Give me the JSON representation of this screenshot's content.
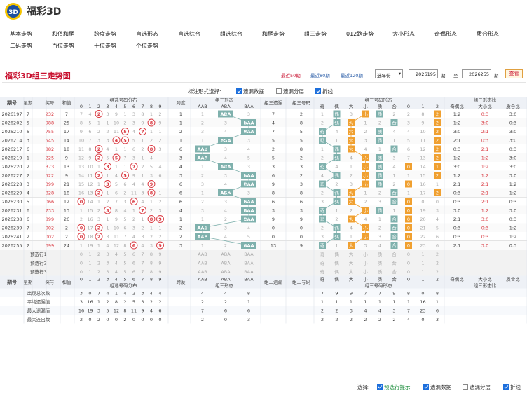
{
  "app": {
    "brand": "福彩3D"
  },
  "nav": [
    "基本走势",
    "和值和尾",
    "跨度走势",
    "直选形态",
    "直选综合",
    "组选综合",
    "和尾走势",
    "组三走势",
    "012路走势",
    "大小形态",
    "奇偶形态",
    "质合形态",
    "二码走势",
    "百位走势",
    "十位走势",
    "个位走势"
  ],
  "page": {
    "title": "福彩3D组三走势图",
    "q50": "最近50期",
    "q80": "最近80期",
    "q120": "最近120期",
    "sel": "选年份",
    "from": "2026195",
    "to": "2026255",
    "qi1": "期",
    "zhi": "至",
    "qi2": "期",
    "btn": "查看"
  },
  "opts": {
    "label": "标注形式选择:",
    "o1": "遗漏数据",
    "o2": "遗漏分层",
    "o3": "折线"
  },
  "bottom": {
    "label": "选择:",
    "o1": "预选行提示",
    "o2": "遗漏数据",
    "o3": "遗漏分层",
    "o4": "折线"
  },
  "headers": {
    "qh": "期号",
    "xq": "星期",
    "kj": "奖号",
    "hz": "和值",
    "fb": "组选号码分布",
    "kd": "跨度",
    "xt": "组三形态",
    "yl": "组三遗漏",
    "hm": "组三号码",
    "zx": "组三号码形态",
    "bz": "组三形态比",
    "jo": "奇偶比",
    "dx": "大小比",
    "zh": "质合比",
    "xt3": [
      "AAB",
      "ABA",
      "BAA"
    ],
    "zx10": [
      "奇",
      "偶",
      "大",
      "小",
      "质",
      "合",
      "0",
      "1",
      "2"
    ],
    "digits": [
      "0",
      "1",
      "2",
      "3",
      "4",
      "5",
      "6",
      "7",
      "8",
      "9"
    ]
  },
  "colors": {
    "red": "#d9363e",
    "teal": "#7fb1ad",
    "orange": "#f0a030",
    "gray": "#aaaaaa"
  },
  "rows": [
    [
      "2026197",
      "7",
      "232",
      "7",
      [
        7,
        4,
        "2",
        3,
        9,
        1,
        3,
        8,
        1,
        2
      ],
      "1",
      "ABA",
      7,
      "2",
      [
        0,
        0,
        0,
        0,
        0,
        0,
        2,
        8,
        "2"
      ],
      "1:2",
      "0:3",
      "3:0"
    ],
    [
      "2026202",
      "5",
      "988",
      "25",
      [
        8,
        5,
        1,
        1,
        10,
        2,
        3,
        9,
        "8",
        9
      ],
      "1",
      "BAA",
      4,
      "8",
      [
        0,
        0,
        0,
        0,
        0,
        0,
        3,
        9,
        "2"
      ],
      "1:2",
      "3:0",
      "0:3"
    ],
    [
      "2026210",
      "6",
      "755",
      "17",
      [
        9,
        6,
        2,
        2,
        11,
        "5",
        4,
        "7",
        1,
        1
      ],
      "2",
      "BAA",
      7,
      "5",
      [
        0,
        0,
        0,
        0,
        0,
        0,
        4,
        10,
        "2"
      ],
      "3:0",
      "2:1",
      "3:0"
    ],
    [
      "2026214",
      "3",
      "545",
      "14",
      [
        10,
        7,
        3,
        3,
        "4",
        "5",
        5,
        1,
        2,
        2
      ],
      "1",
      "ABA",
      5,
      "5",
      [
        0,
        0,
        0,
        0,
        0,
        0,
        5,
        11,
        "2"
      ],
      "2:1",
      "0:3",
      "3:0"
    ],
    [
      "2026217",
      "6",
      "882",
      "18",
      [
        11,
        8,
        "2",
        4,
        1,
        1,
        6,
        2,
        "8",
        3
      ],
      "6",
      "AAB",
      2,
      "8",
      [
        0,
        0,
        0,
        0,
        0,
        0,
        6,
        12,
        "2"
      ],
      "0:3",
      "2:1",
      "0:3"
    ],
    [
      "2026219",
      "1",
      "225",
      "9",
      [
        12,
        9,
        "2",
        5,
        "5",
        7,
        3,
        1,
        4
      ],
      "3",
      "AAB",
      5,
      "2",
      [
        0,
        0,
        0,
        0,
        0,
        0,
        7,
        13,
        "2"
      ],
      "1:2",
      "1:2",
      "3:0"
    ],
    [
      "2026220",
      "2",
      "373",
      "13",
      [
        13,
        10,
        1,
        "3",
        1,
        1,
        "7",
        2,
        5,
        4
      ],
      "4",
      "ABA",
      3,
      "3",
      [
        0,
        0,
        0,
        0,
        0,
        0,
        "0",
        14,
        "1"
      ],
      "3:0",
      "1:2",
      "3:0"
    ],
    [
      "2026227",
      "2",
      "522",
      "9",
      [
        14,
        11,
        "2",
        1,
        4,
        "5",
        9,
        1,
        3,
        6
      ],
      "3",
      "BAA",
      6,
      "2",
      [
        0,
        0,
        0,
        0,
        0,
        0,
        1,
        15,
        "2"
      ],
      "1:2",
      "1:2",
      "3:0"
    ],
    [
      "2026228",
      "3",
      "399",
      "21",
      [
        15,
        12,
        1,
        "3",
        5,
        6,
        4,
        4,
        "9"
      ],
      "6",
      "BAA",
      9,
      "3",
      [
        0,
        0,
        0,
        0,
        0,
        0,
        "0",
        16,
        1
      ],
      "2:1",
      "2:1",
      "1:2"
    ],
    [
      "2026229",
      "4",
      "828",
      "18",
      [
        16,
        13,
        "2",
        1,
        6,
        2,
        11,
        3,
        "8",
        1
      ],
      "6",
      "ABA",
      8,
      "8",
      [
        0,
        0,
        0,
        0,
        0,
        0,
        1,
        17,
        "2"
      ],
      "0:3",
      "2:1",
      "1:2"
    ],
    [
      "2026230",
      "5",
      "066",
      "12",
      [
        "0",
        14,
        1,
        2,
        7,
        3,
        "6",
        4,
        1,
        2
      ],
      "6",
      "BAA",
      6,
      "6",
      [
        0,
        0,
        0,
        0,
        0,
        0,
        "0",
        0,
        0
      ],
      "0:3",
      "2:1",
      "0:3"
    ],
    [
      "2026231",
      "6",
      "733",
      "13",
      [
        1,
        15,
        2,
        "3",
        8,
        4,
        1,
        "7",
        2,
        3
      ],
      "4",
      "BAA",
      3,
      "3",
      [
        0,
        0,
        0,
        0,
        0,
        0,
        "0",
        19,
        3
      ],
      "3:0",
      "1:2",
      "3:0"
    ],
    [
      "2026238",
      "6",
      "899",
      "26",
      [
        2,
        16,
        3,
        1,
        9,
        5,
        2,
        1,
        "8",
        "9"
      ],
      "1",
      "BAA",
      9,
      "9",
      [
        0,
        0,
        0,
        0,
        0,
        0,
        "0",
        20,
        4
      ],
      "2:1",
      "3:0",
      "0:3"
    ],
    [
      "2026239",
      "7",
      "002",
      "2",
      [
        "0",
        17,
        "2",
        1,
        10,
        6,
        3,
        2,
        1,
        1
      ],
      "2",
      "AAB",
      0,
      "0",
      [
        0,
        0,
        0,
        0,
        0,
        0,
        "0",
        21,
        5
      ],
      "0:3",
      "0:3",
      "1:2"
    ],
    [
      "2026241",
      "2",
      "002",
      "2",
      [
        "0",
        18,
        "2",
        3,
        11,
        7,
        4,
        3,
        2,
        2
      ],
      "2",
      "AAB",
      0,
      "0",
      [
        0,
        0,
        0,
        0,
        0,
        0,
        "0",
        22,
        6
      ],
      "0:3",
      "0:3",
      "1:2"
    ],
    [
      "2026255",
      "2",
      "699",
      "24",
      [
        1,
        19,
        1,
        4,
        12,
        8,
        "6",
        4,
        3,
        "9"
      ],
      "3",
      "BAA",
      13,
      "9",
      [
        0,
        0,
        0,
        0,
        0,
        0,
        "0",
        23,
        6
      ],
      "2:1",
      "3:0",
      "0:3"
    ]
  ],
  "pre": [
    "预选行1",
    "预选行2",
    "预选行3"
  ],
  "stats": [
    {
      "label": "出现总次数",
      "d": [
        "3",
        "0",
        "7",
        "4",
        "1",
        "4",
        "2",
        "3",
        "4",
        "4"
      ],
      "x": [
        "4",
        "4",
        "8"
      ],
      "z": [
        "7",
        "9",
        "9",
        "7",
        "7",
        "9",
        "8",
        "0",
        "8"
      ]
    },
    {
      "label": "平均遗漏值",
      "d": [
        "3",
        "16",
        "1",
        "2",
        "8",
        "2",
        "5",
        "3",
        "2",
        "2"
      ],
      "x": [
        "2",
        "2",
        "1"
      ],
      "z": [
        "1",
        "1",
        "1",
        "1",
        "1",
        "1",
        "1",
        "16",
        "1"
      ]
    },
    {
      "label": "最大遗漏值",
      "d": [
        "16",
        "19",
        "3",
        "5",
        "12",
        "8",
        "11",
        "9",
        "4",
        "6"
      ],
      "x": [
        "7",
        "6",
        "6"
      ],
      "z": [
        "2",
        "2",
        "3",
        "4",
        "4",
        "3",
        "7",
        "23",
        "6"
      ]
    },
    {
      "label": "最大连出数",
      "d": [
        "2",
        "0",
        "2",
        "0",
        "0",
        "2",
        "0",
        "0",
        "0",
        "0"
      ],
      "x": [
        "2",
        "0",
        "3"
      ],
      "z": [
        "2",
        "2",
        "2",
        "2",
        "2",
        "2",
        "4",
        "0",
        "3"
      ]
    }
  ]
}
